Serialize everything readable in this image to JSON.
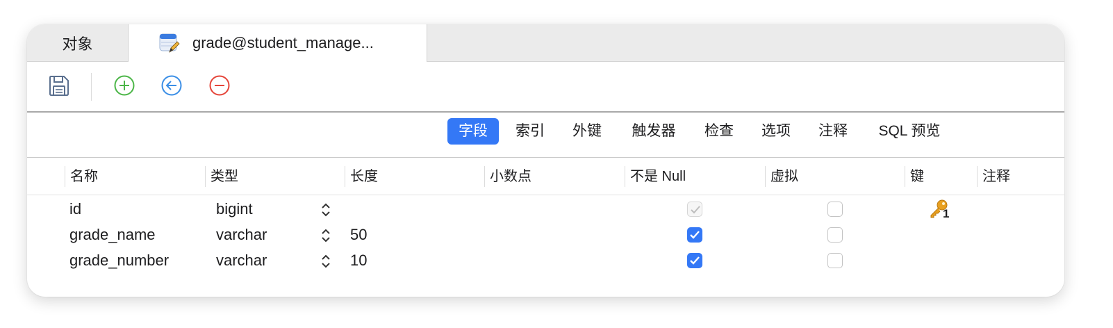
{
  "tabs": [
    {
      "label": "对象"
    },
    {
      "label": "grade@student_manage..."
    }
  ],
  "toolbar": {
    "save": "save-icon",
    "add": "add-field-icon",
    "insert": "insert-field-icon",
    "delete": "delete-field-icon"
  },
  "segments": [
    {
      "label": "字段",
      "active": true
    },
    {
      "label": "索引"
    },
    {
      "label": "外键"
    },
    {
      "label": "触发器"
    },
    {
      "label": "检查"
    },
    {
      "label": "选项"
    },
    {
      "label": "注释"
    },
    {
      "label": "SQL 预览"
    }
  ],
  "columns": [
    "名称",
    "类型",
    "长度",
    "小数点",
    "不是 Null",
    "虚拟",
    "键",
    "注释"
  ],
  "rows": [
    {
      "name": "id",
      "type": "bigint",
      "length": "",
      "decimals": "",
      "not_null": true,
      "not_null_disabled": true,
      "virtual": false,
      "key": "1",
      "comment": ""
    },
    {
      "name": "grade_name",
      "type": "varchar",
      "length": "50",
      "decimals": "",
      "not_null": true,
      "not_null_disabled": false,
      "virtual": false,
      "key": "",
      "comment": ""
    },
    {
      "name": "grade_number",
      "type": "varchar",
      "length": "10",
      "decimals": "",
      "not_null": true,
      "not_null_disabled": false,
      "virtual": false,
      "key": "",
      "comment": ""
    }
  ],
  "colors": {
    "accent": "#3478f6",
    "add": "#4cb648",
    "insert": "#3a8ee6",
    "delete": "#e5453a",
    "key": "#e8a020"
  }
}
